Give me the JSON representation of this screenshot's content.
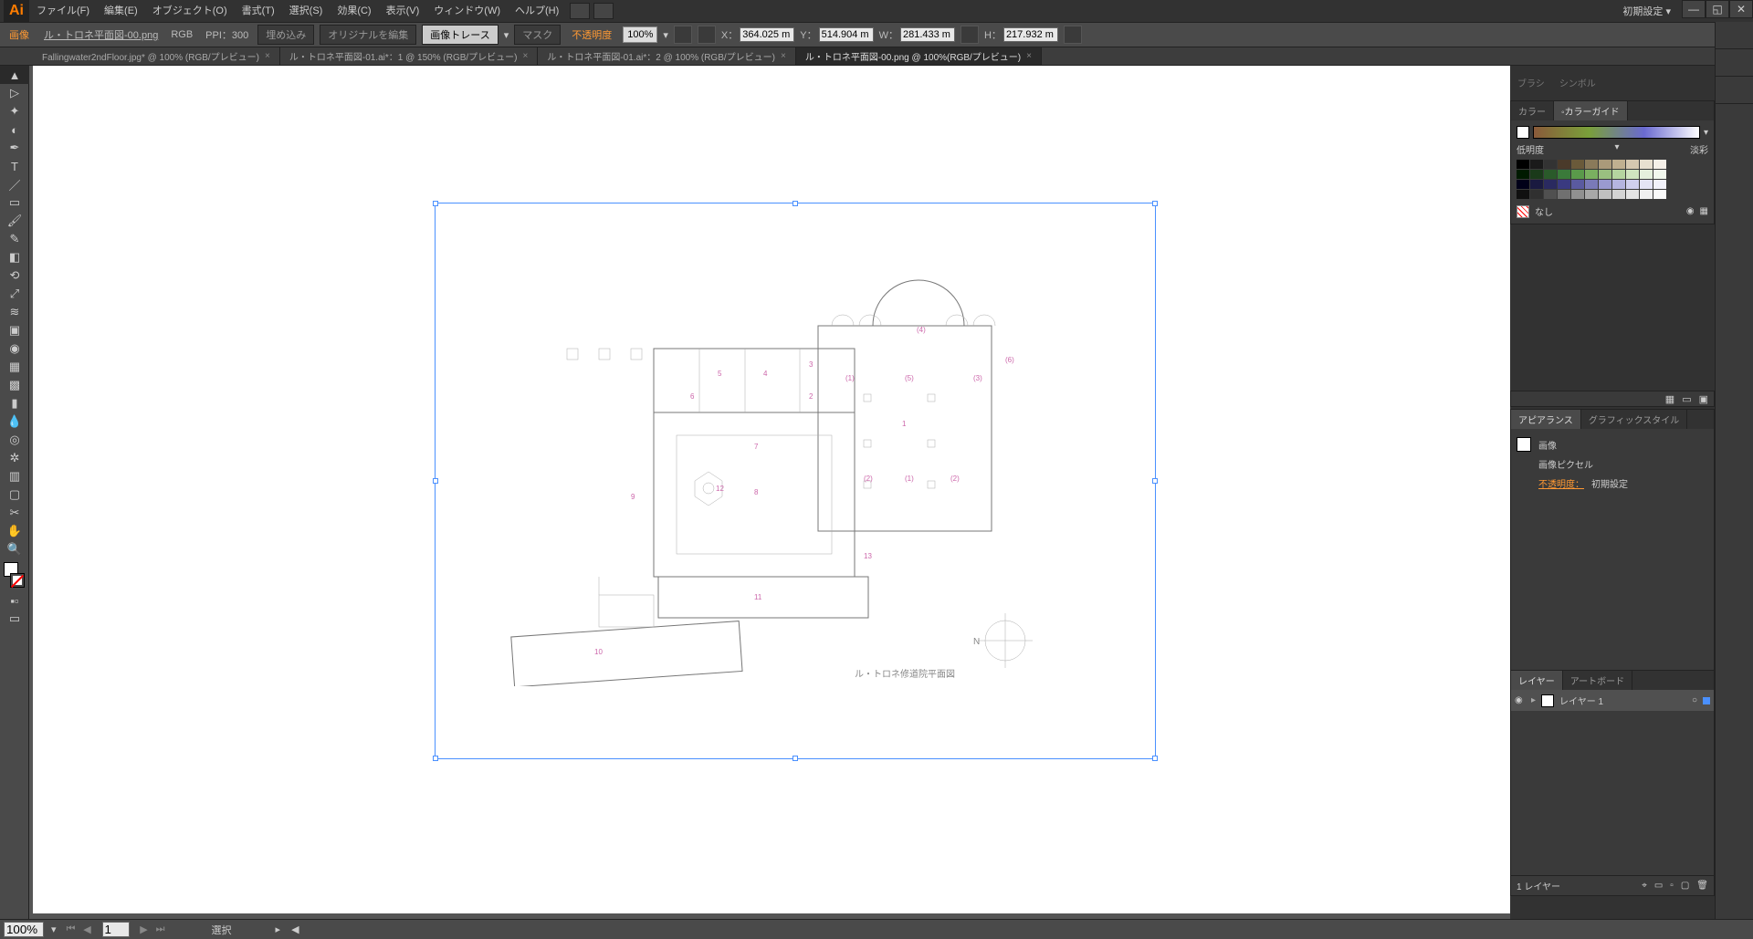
{
  "menu": {
    "items": [
      "ファイル(F)",
      "編集(E)",
      "オブジェクト(O)",
      "書式(T)",
      "選択(S)",
      "効果(C)",
      "表示(V)",
      "ウィンドウ(W)",
      "ヘルプ(H)"
    ]
  },
  "workspace_label": "初期設定",
  "opt": {
    "mode": "画像",
    "filename": "ル・トロネ平面図-00.png",
    "colormode": "RGB",
    "ppi": "PPI：300",
    "embed": "埋め込み",
    "edit_original": "オリジナルを編集",
    "trace": "画像トレース",
    "mask": "マスク",
    "opacity_label": "不透明度",
    "opacity_value": "100%",
    "x_label": "X：",
    "x": "364.025 m",
    "y_label": "Y：",
    "y": "514.904 m",
    "w_label": "W：",
    "w": "281.433 m",
    "h_label": "H：",
    "h": "217.932 m"
  },
  "tabs": [
    {
      "label": "Fallingwater2ndFloor.jpg* @ 100% (RGB/プレビュー)",
      "active": false
    },
    {
      "label": "ル・トロネ平面図-01.ai*：1 @ 150% (RGB/プレビュー)",
      "active": false
    },
    {
      "label": "ル・トロネ平面図-01.ai*：2 @ 100% (RGB/プレビュー)",
      "active": false
    },
    {
      "label": "ル・トロネ平面図-00.png @ 100%(RGB/プレビュー)",
      "active": true
    }
  ],
  "right_tabs_top": [
    "ブラシ",
    "シンボル"
  ],
  "color_panel": {
    "tabs": [
      "カラー",
      "◦カラーガイド"
    ],
    "low": "低明度",
    "high": "淡彩",
    "none": "なし"
  },
  "appear_panel": {
    "tabs": [
      "アピアランス",
      "グラフィックスタイル"
    ],
    "item": "画像",
    "pixel": "画像ピクセル",
    "opacity_label": "不透明度：",
    "opacity_value": "初期設定"
  },
  "layer_panel": {
    "tabs": [
      "レイヤー",
      "アートボード"
    ],
    "layer_name": "レイヤー 1",
    "footer": "1 レイヤー"
  },
  "plan": {
    "caption": "ル・トロネ修道院平面図",
    "north": "N",
    "numbers": [
      "1",
      "2",
      "3",
      "4",
      "5",
      "6",
      "7",
      "8",
      "9",
      "10",
      "11",
      "12",
      "13",
      "(1)",
      "(1)",
      "(2)",
      "(2)",
      "(4)",
      "(5)",
      "(6)"
    ]
  },
  "status": {
    "zoom": "100%",
    "artboard": "1",
    "tool": "選択",
    "layer_count": "1 レイヤー"
  }
}
